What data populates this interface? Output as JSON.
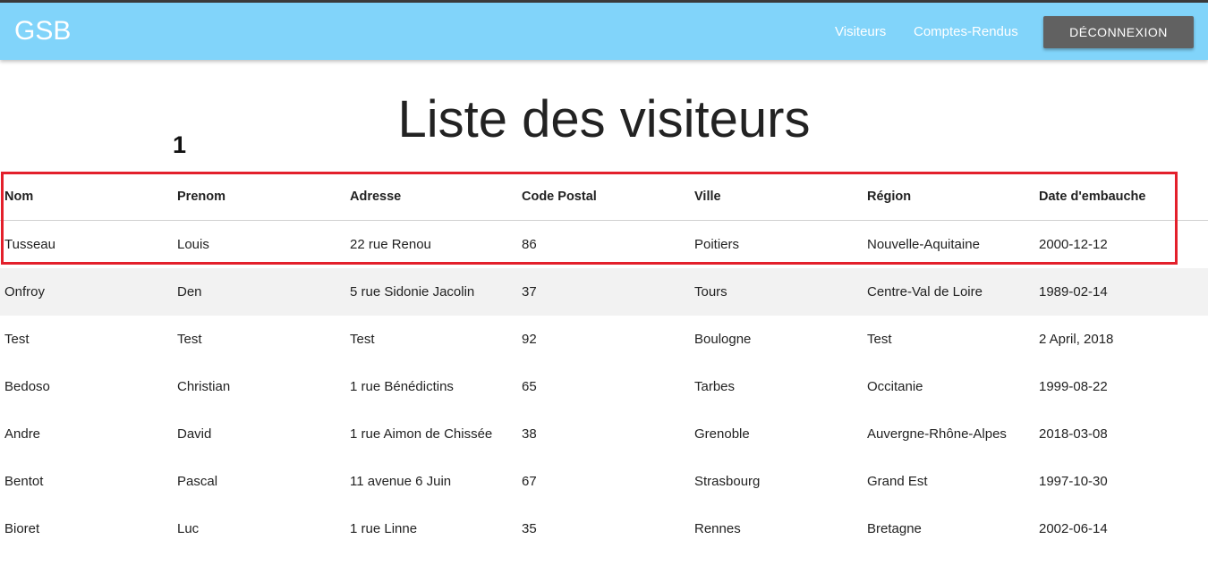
{
  "navbar": {
    "brand": "GSB",
    "links": [
      "Visiteurs",
      "Comptes-Rendus"
    ],
    "logout_label": "DÉCONNEXION"
  },
  "page": {
    "title": "Liste des visiteurs",
    "annotation": "1"
  },
  "colors": {
    "navbar_bg": "#81d4fa",
    "button_bg": "#616161",
    "highlight": "#e3202b",
    "stripe": "#f2f2f2"
  },
  "table": {
    "headers": [
      "Nom",
      "Prenom",
      "Adresse",
      "Code Postal",
      "Ville",
      "Région",
      "Date d'embauche"
    ],
    "rows": [
      [
        "Tusseau",
        "Louis",
        "22 rue Renou",
        "86",
        "Poitiers",
        "Nouvelle-Aquitaine",
        "2000-12-12"
      ],
      [
        "Onfroy",
        "Den",
        "5 rue Sidonie Jacolin",
        "37",
        "Tours",
        "Centre-Val de Loire",
        "1989-02-14"
      ],
      [
        "Test",
        "Test",
        "Test",
        "92",
        "Boulogne",
        "Test",
        "2 April, 2018"
      ],
      [
        "Bedoso",
        "Christian",
        "1 rue Bénédictins",
        "65",
        "Tarbes",
        "Occitanie",
        "1999-08-22"
      ],
      [
        "Andre",
        "David",
        "1 rue Aimon de Chissée",
        "38",
        "Grenoble",
        "Auvergne-Rhône-Alpes",
        "2018-03-08"
      ],
      [
        "Bentot",
        "Pascal",
        "11 avenue 6 Juin",
        "67",
        "Strasbourg",
        "Grand Est",
        "1997-10-30"
      ],
      [
        "Bioret",
        "Luc",
        "1 rue Linne",
        "35",
        "Rennes",
        "Bretagne",
        "2002-06-14"
      ]
    ]
  }
}
